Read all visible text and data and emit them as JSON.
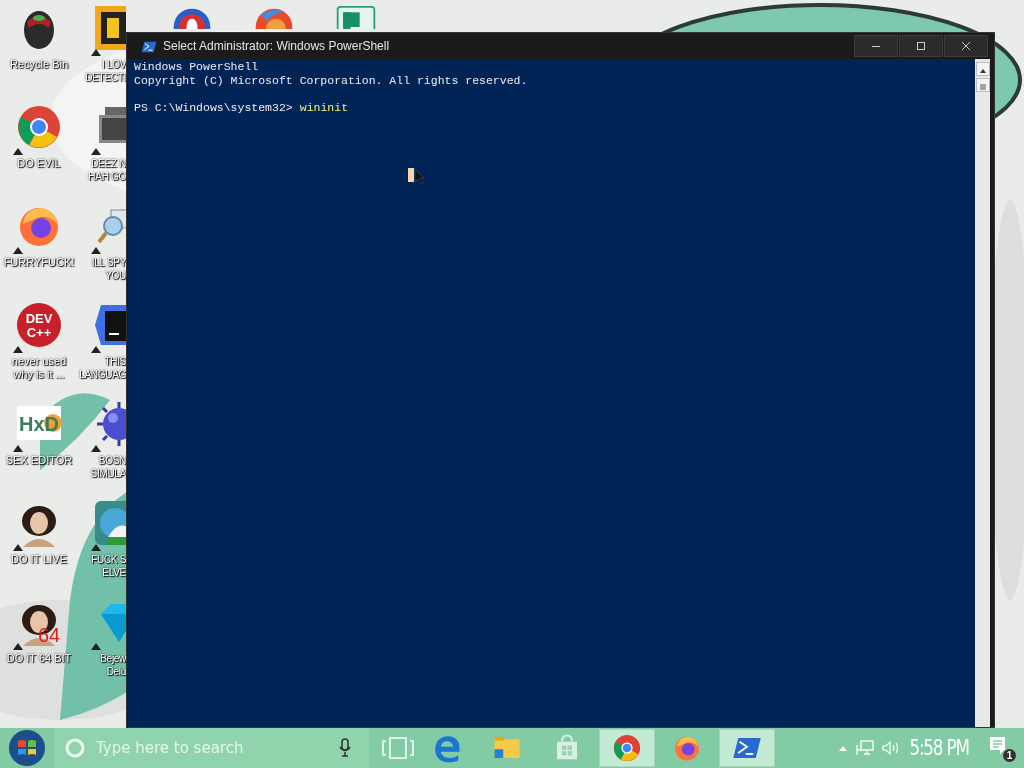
{
  "desktop": {
    "icon_columns": [
      [
        {
          "label": "Recycle Bin",
          "kind": "recycle",
          "shortcut": false
        },
        {
          "label": "DO EVIL",
          "kind": "chrome",
          "shortcut": true
        },
        {
          "label": "FURRYFUCK!",
          "kind": "firefox",
          "shortcut": true
        },
        {
          "label": "never used why is it ...",
          "kind": "devcpp",
          "logo_text": "DEV C++",
          "shortcut": true
        },
        {
          "label": "SEX EDITOR",
          "kind": "hxd",
          "logo_text": "HxD",
          "shortcut": true
        },
        {
          "label": "DO IT LIVE",
          "kind": "portrait",
          "shortcut": true
        },
        {
          "label": "DO IT 64 BIT",
          "kind": "portrait",
          "logo_text": "64",
          "shortcut": true
        }
      ],
      [
        {
          "label": "I LOV\nDETECTI",
          "kind": "detective",
          "shortcut": true
        },
        {
          "label": "DEEZ N\nHAH GO",
          "kind": "stack",
          "shortcut": true
        },
        {
          "label": "ILL SPY\nYOU",
          "kind": "spy",
          "shortcut": true
        },
        {
          "label": "THIS\nLANGUAG",
          "kind": "goland",
          "shortcut": true
        },
        {
          "label": "BOSN\nSIMULA",
          "kind": "virus",
          "shortcut": true
        },
        {
          "label": "FUCK S\nELVE",
          "kind": "elves",
          "shortcut": true
        },
        {
          "label": "Bejew\nDelu",
          "kind": "gem",
          "shortcut": true
        }
      ]
    ],
    "top_icons": [
      {
        "kind": "ring"
      },
      {
        "kind": "orb"
      },
      {
        "kind": "publisher"
      }
    ]
  },
  "window": {
    "title": "Select Administrator: Windows PowerShell",
    "console": {
      "lines": [
        "Windows PowerShell",
        "Copyright (C) Microsoft Corporation. All rights reserved."
      ],
      "prompt": "PS C:\\Windows\\system32>",
      "command": "wininit"
    }
  },
  "taskbar": {
    "search": {
      "placeholder": "Type here to search"
    },
    "apps": [
      {
        "kind": "edge",
        "active": false
      },
      {
        "kind": "explorer",
        "active": false
      },
      {
        "kind": "store",
        "active": false
      },
      {
        "kind": "chrome",
        "active": true
      },
      {
        "kind": "firefox",
        "active": false
      },
      {
        "kind": "powershell",
        "active": true
      }
    ],
    "clock": "5:58 PM",
    "notification_count": "1"
  }
}
